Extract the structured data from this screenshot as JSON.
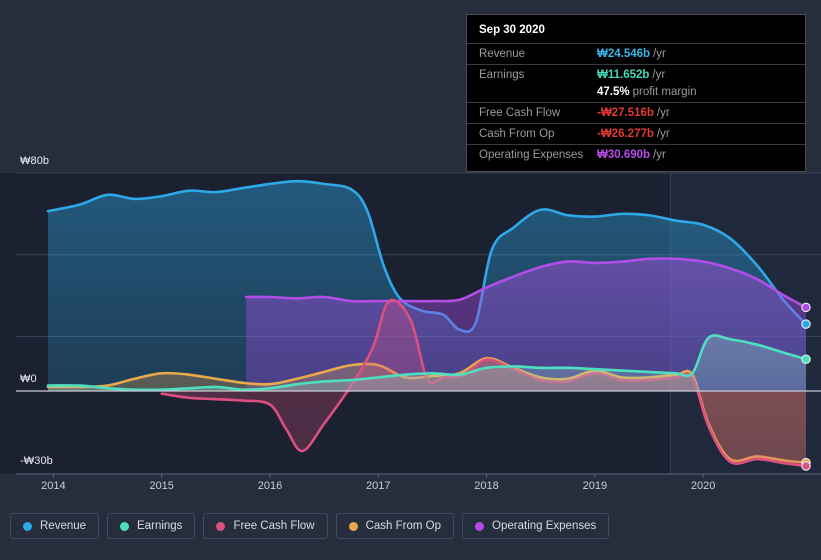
{
  "tooltip": {
    "title": "Sep 30 2020",
    "rows": [
      {
        "label": "Revenue",
        "value": "₩24.546b",
        "unit": "/yr",
        "color_class": "c-rev"
      },
      {
        "label": "Earnings",
        "value": "₩11.652b",
        "unit": "/yr",
        "color_class": "c-earn"
      },
      {
        "label": "",
        "value": "47.5%",
        "unit": "profit margin",
        "color_class": "c-white"
      },
      {
        "label": "Free Cash Flow",
        "value": "-₩27.516b",
        "unit": "/yr",
        "color_class": "c-neg"
      },
      {
        "label": "Cash From Op",
        "value": "-₩26.277b",
        "unit": "/yr",
        "color_class": "c-neg"
      },
      {
        "label": "Operating Expenses",
        "value": "₩30.690b",
        "unit": "/yr",
        "color_class": "c-opex"
      }
    ]
  },
  "axes": {
    "y_top_label": "₩80b",
    "y_zero_label": "₩0",
    "y_bottom_label": "-₩30b",
    "x_labels": [
      "2014",
      "2015",
      "2016",
      "2017",
      "2018",
      "2019",
      "2020"
    ]
  },
  "legend": {
    "items": [
      {
        "label": "Revenue",
        "color": "#2DA8E8"
      },
      {
        "label": "Earnings",
        "color": "#4DDFC0"
      },
      {
        "label": "Free Cash Flow",
        "color": "#DB5081"
      },
      {
        "label": "Cash From Op",
        "color": "#E8A94D"
      },
      {
        "label": "Operating Expenses",
        "color": "#B34DE8"
      }
    ]
  },
  "chart_data": {
    "type": "area",
    "title": "",
    "xlabel": "",
    "ylabel": "",
    "currency": "KRW (₩), billions",
    "xlim": [
      2013.95,
      2020.95
    ],
    "ylim": [
      -32,
      85
    ],
    "yticks": [
      80,
      0,
      -30
    ],
    "ytick_labels": [
      "₩80b",
      "₩0",
      "-₩30b"
    ],
    "xticks": [
      2014,
      2015,
      2016,
      2017,
      2018,
      2019,
      2020
    ],
    "grid": true,
    "gridlines_y": [
      80,
      50,
      20
    ],
    "zero_line": 0,
    "forecast_band_start": 2019.7,
    "legend_position": "bottom",
    "series": [
      {
        "name": "Revenue",
        "color": "#2DA8E8",
        "x": [
          2013.95,
          2014.25,
          2014.5,
          2014.75,
          2015.0,
          2015.25,
          2015.5,
          2015.75,
          2016.0,
          2016.25,
          2016.5,
          2016.75,
          2016.9,
          2017.05,
          2017.2,
          2017.4,
          2017.6,
          2017.75,
          2017.9,
          2018.05,
          2018.25,
          2018.5,
          2018.75,
          2019.0,
          2019.25,
          2019.5,
          2019.75,
          2020.0,
          2020.25,
          2020.5,
          2020.75,
          2020.95
        ],
        "values": [
          66.0,
          68.5,
          72.0,
          70.5,
          71.5,
          73.5,
          73.0,
          74.5,
          76.0,
          77.0,
          76.0,
          74.0,
          66.0,
          46.0,
          34.0,
          29.5,
          28.0,
          22.5,
          25.0,
          52.0,
          60.0,
          66.5,
          64.5,
          64.0,
          65.0,
          64.5,
          62.5,
          61.0,
          56.0,
          46.0,
          33.0,
          24.5
        ]
      },
      {
        "name": "Operating Expenses",
        "color": "#B34DE8",
        "x": [
          2015.78,
          2016.0,
          2016.25,
          2016.5,
          2016.75,
          2017.0,
          2017.25,
          2017.5,
          2017.75,
          2018.0,
          2018.25,
          2018.5,
          2018.75,
          2019.0,
          2019.25,
          2019.5,
          2019.75,
          2020.0,
          2020.25,
          2020.5,
          2020.75,
          2020.95
        ],
        "values": [
          34.5,
          34.5,
          34.0,
          34.5,
          33.0,
          33.0,
          33.0,
          33.0,
          33.5,
          38.0,
          42.0,
          45.5,
          47.5,
          47.0,
          47.5,
          48.5,
          48.5,
          47.5,
          45.0,
          41.0,
          35.0,
          30.7
        ]
      },
      {
        "name": "Cash From Op",
        "color": "#E8A94D",
        "x": [
          2013.95,
          2014.25,
          2014.5,
          2014.75,
          2015.0,
          2015.25,
          2015.5,
          2015.75,
          2016.0,
          2016.25,
          2016.5,
          2016.75,
          2017.0,
          2017.25,
          2017.5,
          2017.75,
          2018.0,
          2018.25,
          2018.5,
          2018.75,
          2019.0,
          2019.25,
          2019.5,
          2019.75,
          2019.9,
          2020.05,
          2020.25,
          2020.5,
          2020.75,
          2020.95
        ],
        "values": [
          1.5,
          1.5,
          2.0,
          4.5,
          6.5,
          6.0,
          4.5,
          3.0,
          2.5,
          4.5,
          7.0,
          9.5,
          9.5,
          5.0,
          5.5,
          6.5,
          12.0,
          8.5,
          5.0,
          4.5,
          7.5,
          5.0,
          5.0,
          6.0,
          6.0,
          -12.0,
          -25.0,
          -24.0,
          -25.5,
          -26.3
        ]
      },
      {
        "name": "Free Cash Flow",
        "color": "#DB5081",
        "x": [
          2015.0,
          2015.25,
          2015.5,
          2015.75,
          2016.0,
          2016.15,
          2016.3,
          2016.5,
          2016.75,
          2016.95,
          2017.1,
          2017.3,
          2017.45,
          2017.6,
          2017.8,
          2018.0,
          2018.25,
          2018.5,
          2018.75,
          2019.0,
          2019.25,
          2019.5,
          2019.75,
          2019.9,
          2020.05,
          2020.25,
          2020.5,
          2020.75,
          2020.95
        ],
        "values": [
          -1.0,
          -2.5,
          -3.0,
          -3.5,
          -5.0,
          -14.0,
          -22.0,
          -12.0,
          2.0,
          16.0,
          33.0,
          26.0,
          4.5,
          5.0,
          6.0,
          11.5,
          8.0,
          4.0,
          3.5,
          6.5,
          4.0,
          4.0,
          5.0,
          5.0,
          -13.0,
          -26.0,
          -25.0,
          -26.5,
          -27.5
        ]
      },
      {
        "name": "Earnings",
        "color": "#4DDFC0",
        "x": [
          2013.95,
          2014.25,
          2014.5,
          2014.75,
          2015.0,
          2015.25,
          2015.5,
          2015.75,
          2016.0,
          2016.25,
          2016.5,
          2016.75,
          2017.0,
          2017.25,
          2017.5,
          2017.75,
          2018.0,
          2018.25,
          2018.5,
          2018.75,
          2019.0,
          2019.25,
          2019.5,
          2019.75,
          2019.9,
          2020.05,
          2020.25,
          2020.5,
          2020.75,
          2020.95
        ],
        "values": [
          2.0,
          2.0,
          1.0,
          0.5,
          0.5,
          1.0,
          1.5,
          0.5,
          1.0,
          2.5,
          3.5,
          4.0,
          5.0,
          6.0,
          6.5,
          6.0,
          8.5,
          9.0,
          8.5,
          8.5,
          8.0,
          7.5,
          7.0,
          6.5,
          6.5,
          19.5,
          19.0,
          17.0,
          14.0,
          11.7
        ]
      }
    ],
    "endpoints": [
      {
        "name": "Operating Expenses",
        "value": 30.69,
        "color": "#B34DE8"
      },
      {
        "name": "Revenue",
        "value": 24.55,
        "color": "#2DA8E8"
      },
      {
        "name": "Earnings",
        "value": 11.65,
        "color": "#4DDFC0"
      },
      {
        "name": "Cash From Op",
        "value": -26.28,
        "color": "#E8A94D"
      },
      {
        "name": "Free Cash Flow",
        "value": -27.52,
        "color": "#DB5081"
      }
    ]
  }
}
